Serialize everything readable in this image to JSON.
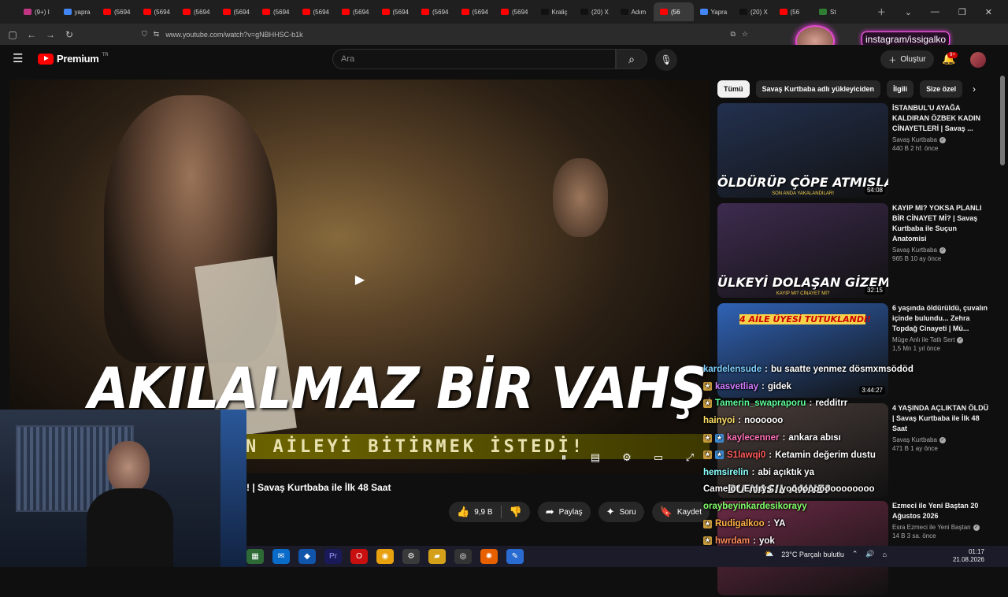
{
  "browser": {
    "tabs": [
      {
        "label": "(9+) I",
        "color": "#c13584"
      },
      {
        "label": "yapra",
        "color": "#4285f4"
      },
      {
        "label": "(5694",
        "color": "#ff0000"
      },
      {
        "label": "(5694",
        "color": "#ff0000"
      },
      {
        "label": "(5694",
        "color": "#ff0000"
      },
      {
        "label": "(5694",
        "color": "#ff0000"
      },
      {
        "label": "(5694",
        "color": "#ff0000"
      },
      {
        "label": "(5694",
        "color": "#ff0000"
      },
      {
        "label": "(5694",
        "color": "#ff0000"
      },
      {
        "label": "(5694",
        "color": "#ff0000"
      },
      {
        "label": "(5694",
        "color": "#ff0000"
      },
      {
        "label": "(5694",
        "color": "#ff0000"
      },
      {
        "label": "(5694",
        "color": "#ff0000"
      },
      {
        "label": "Kraliç",
        "color": "#111111"
      },
      {
        "label": "(20) X",
        "color": "#111111"
      },
      {
        "label": "Adım",
        "color": "#111111"
      },
      {
        "label": "(56",
        "color": "#ff0000",
        "active": true
      },
      {
        "label": "Yapra",
        "color": "#4285f4"
      },
      {
        "label": "(20) X",
        "color": "#111111"
      },
      {
        "label": "(56",
        "color": "#ff0000"
      },
      {
        "label": "St",
        "color": "#2e7d32"
      }
    ],
    "url": "www.youtube.com/watch?v=gNBHHSC-b1k"
  },
  "overlay": {
    "instagram_handle": "instagram/issigalko"
  },
  "youtube": {
    "logo_text": "Premium",
    "logo_country": "TR",
    "search_placeholder": "Ara",
    "create_label": "Oluştur",
    "notification_badge": "9+"
  },
  "video": {
    "headline": "AKILALMAZ BİR VAHŞET",
    "strip_text": "N AİLEYİ BİTİRMEK İSTEDİ!",
    "title_visible": "! | Savaş Kurtbaba ile İlk 48 Saat",
    "likes": "9,9 B",
    "share_label": "Paylaş",
    "ask_label": "Soru",
    "save_label": "Kaydet"
  },
  "chips": [
    "Tümü",
    "Savaş Kurtbaba adlı yükleyiciden",
    "İlgili",
    "Size özel"
  ],
  "recommendations": [
    {
      "title": "İSTANBUL'U AYAĞA KALDIRAN ÖZBEK KADIN CİNAYETLERİ | Savaş ...",
      "channel": "Savaş Kurtbaba",
      "stats": "440 B  2 hf. önce",
      "duration": "54:08",
      "thumb_text": "ÖLDÜRÜP ÇÖPE ATMIŞLAR!",
      "thumb_sub": "SON ANDA YAKALANDILAR!",
      "thumb_color": "#23314f"
    },
    {
      "title": "KAYIP MI? YOKSA PLANLI BİR CİNAYET Mİ? | Savaş Kurtbaba ile Suçun Anatomisi",
      "channel": "Savaş Kurtbaba",
      "stats": "965 B  10 ay önce",
      "duration": "32:15",
      "thumb_text": "ÜLKEYİ DOLAŞAN GİZEMLİ KAYIP",
      "thumb_sub": "KAYIP MI? CİNAYET Mİ?",
      "thumb_color": "#3e2b4f"
    },
    {
      "title": "6 yaşında öldürüldü, çuvalın içinde bulundu... Zehra Topdağ Cinayeti | Mü...",
      "channel": "Müge Anlı ile Tatlı Sert",
      "stats": "1,5 Mn  1 yıl önce",
      "duration": "3:44:27",
      "thumb_text": "4 AİLE ÜYESİ TUTUKLANDI!",
      "thumb_sub": "",
      "thumb_color": "#3063b6"
    },
    {
      "title": "4 YAŞINDA AÇLIKTAN ÖLDÜ | Savaş Kurtbaba ile İlk 48 Saat",
      "channel": "Savaş Kurtbaba",
      "stats": "471 B  1 ay önce",
      "duration": "",
      "thumb_text": "BU NASIL ANNE?",
      "thumb_sub": "",
      "thumb_color": "#4a3e3a"
    },
    {
      "title": "Ezmeci ile Yeni Baştan 20 Ağustos 2026",
      "channel": "Esra Ezmeci ile Yeni Baştan",
      "stats": "14 B  3 sa. önce",
      "duration": "",
      "thumb_text": "",
      "thumb_sub": "",
      "thumb_color": "#6b2a44"
    }
  ],
  "chat": [
    {
      "user": "kardelensude",
      "msg": "bu saatte yenmez dösmxmsödöd",
      "color": "#7fd0ff",
      "badges": 0
    },
    {
      "user": "kasvetliay",
      "msg": "gidek",
      "color": "#d37cff",
      "badges": 1
    },
    {
      "user": "Tamerin_swapraporu",
      "msg": "redditrr",
      "color": "#5dff9a",
      "badges": 1
    },
    {
      "user": "hainyoi",
      "msg": "noooooo",
      "color": "#ffe066",
      "badges": 0
    },
    {
      "user": "kaylecenner",
      "msg": "ankara abısı",
      "color": "#ff6fb5",
      "badges": 2
    },
    {
      "user": "S1lawqi0",
      "msg": "Ketamin değerim dustu",
      "color": "#ff5a5a",
      "badges": 2
    },
    {
      "user": "hemsirelin",
      "msg": "abi açıktık ya",
      "color": "#8affff",
      "badges": 0
    },
    {
      "user": "Camelot_Emrys",
      "msg": "yoooooooooooooooo",
      "color": "#ffffff",
      "badges": 0
    },
    {
      "user": "oraybeyinkardesikorayy",
      "msg": "",
      "color": "#7fff6a",
      "badges": 0
    },
    {
      "user": "Rudigalkoo",
      "msg": "YA",
      "color": "#ffb347",
      "badges": 1
    },
    {
      "user": "hwrdam",
      "msg": "yok",
      "color": "#ff8c5a",
      "badges": 1
    }
  ],
  "taskbar": {
    "weather": "23°C  Parçalı bulutlu",
    "time": "01:17",
    "date": "21.08.2026"
  }
}
